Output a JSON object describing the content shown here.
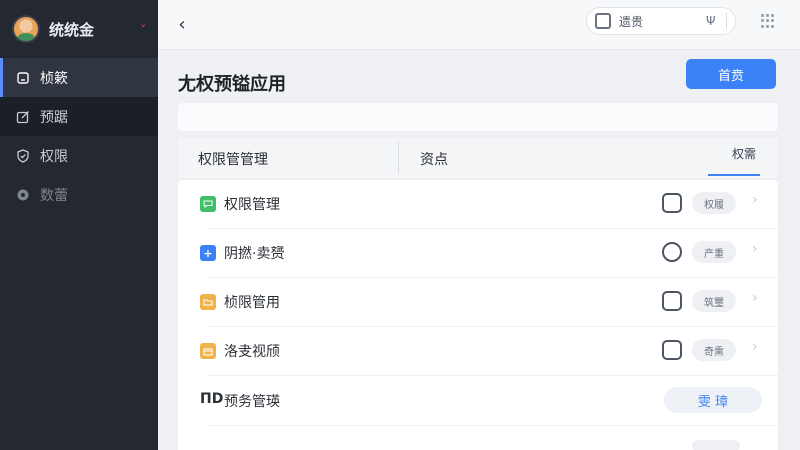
{
  "sidebar": {
    "user_name": "统统金",
    "caret": "˅",
    "items": [
      {
        "label": "桢簌",
        "icon": "home-icon"
      },
      {
        "label": "预踞",
        "icon": "edit-icon"
      },
      {
        "label": "权限",
        "icon": "shield-icon"
      },
      {
        "label": "数蕾",
        "icon": "gear-icon"
      }
    ]
  },
  "topbar": {
    "back": "‹",
    "pill_label": "遗贵",
    "mic": "Ψ"
  },
  "page": {
    "title": "尢权预镒应用",
    "primary_button": "首贲"
  },
  "tabs": {
    "tab1": "权限管管理",
    "tab2": "资点",
    "tab3": "权需"
  },
  "rows": [
    {
      "label": "权限管理",
      "icon": "chat-icon",
      "color": "#3fbf6a",
      "tag": "权履",
      "chev": "›"
    },
    {
      "label": "阴撚·卖赟",
      "icon": "plus-icon",
      "color": "#3b82f6",
      "tag": "产重",
      "chev": "›"
    },
    {
      "label": "桢限管用",
      "icon": "folder-icon",
      "color": "#f0b24a",
      "tag": "筑璽",
      "chev": "›"
    },
    {
      "label": "洛叏视颀",
      "icon": "calendar-icon",
      "color": "#f0b24a",
      "tag": "奇熏",
      "chev": "›"
    },
    {
      "prefix": "ΠD",
      "label": "预务管瑛",
      "button": "雯 璋"
    }
  ],
  "colors": {
    "sidebar_bg": "#232831",
    "accent": "#3b82f6"
  }
}
